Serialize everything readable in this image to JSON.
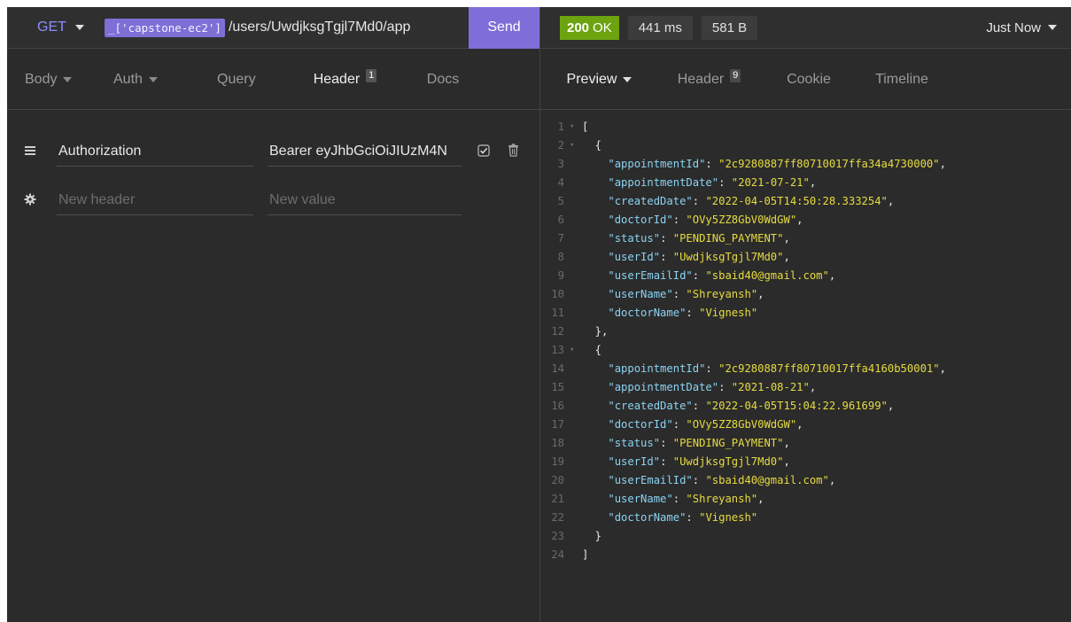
{
  "request": {
    "method": "GET",
    "env_tag": "_['capstone-ec2']",
    "url_path": "/users/UwdjksgTgjl7Md0/app",
    "send_label": "Send"
  },
  "response": {
    "status_code": "200",
    "status_text": "OK",
    "time": "441 ms",
    "size": "581 B",
    "timestamp": "Just Now"
  },
  "request_tabs": [
    {
      "label": "Body"
    },
    {
      "label": "Auth"
    },
    {
      "label": "Query"
    },
    {
      "label": "Header",
      "badge": "1"
    },
    {
      "label": "Docs"
    }
  ],
  "response_tabs": [
    {
      "label": "Preview"
    },
    {
      "label": "Header",
      "badge": "9"
    },
    {
      "label": "Cookie"
    },
    {
      "label": "Timeline"
    }
  ],
  "headers": {
    "row": {
      "name": "Authorization",
      "value": "Bearer eyJhbGciOiJIUzM4N"
    },
    "new_name_placeholder": "New header",
    "new_value_placeholder": "New value"
  },
  "response_body": {
    "line_numbers": [
      "1",
      "2",
      "3",
      "4",
      "5",
      "6",
      "7",
      "8",
      "9",
      "10",
      "11",
      "12",
      "13",
      "14",
      "15",
      "16",
      "17",
      "18",
      "19",
      "20",
      "21",
      "22",
      "23",
      "24"
    ],
    "appointments": [
      {
        "appointmentId": "2c9280887ff80710017ffa34a4730000",
        "appointmentDate": "2021-07-21",
        "createdDate": "2022-04-05T14:50:28.333254",
        "doctorId": "OVy5ZZ8GbV0WdGW",
        "status": "PENDING_PAYMENT",
        "userId": "UwdjksgTgjl7Md0",
        "userEmailId": "sbaid40@gmail.com",
        "userName": "Shreyansh",
        "doctorName": "Vignesh"
      },
      {
        "appointmentId": "2c9280887ff80710017ffa4160b50001",
        "appointmentDate": "2021-08-21",
        "createdDate": "2022-04-05T15:04:22.961699",
        "doctorId": "OVy5ZZ8GbV0WdGW",
        "status": "PENDING_PAYMENT",
        "userId": "UwdjksgTgjl7Md0",
        "userEmailId": "sbaid40@gmail.com",
        "userName": "Shreyansh",
        "doctorName": "Vignesh"
      }
    ]
  },
  "colors": {
    "background": "#2b2b2b",
    "accent": "#7f6ed9",
    "status_ok": "#6ca30f",
    "json_key": "#8ad3f3",
    "json_string": "#e6db40",
    "method": "#8e8dff"
  }
}
